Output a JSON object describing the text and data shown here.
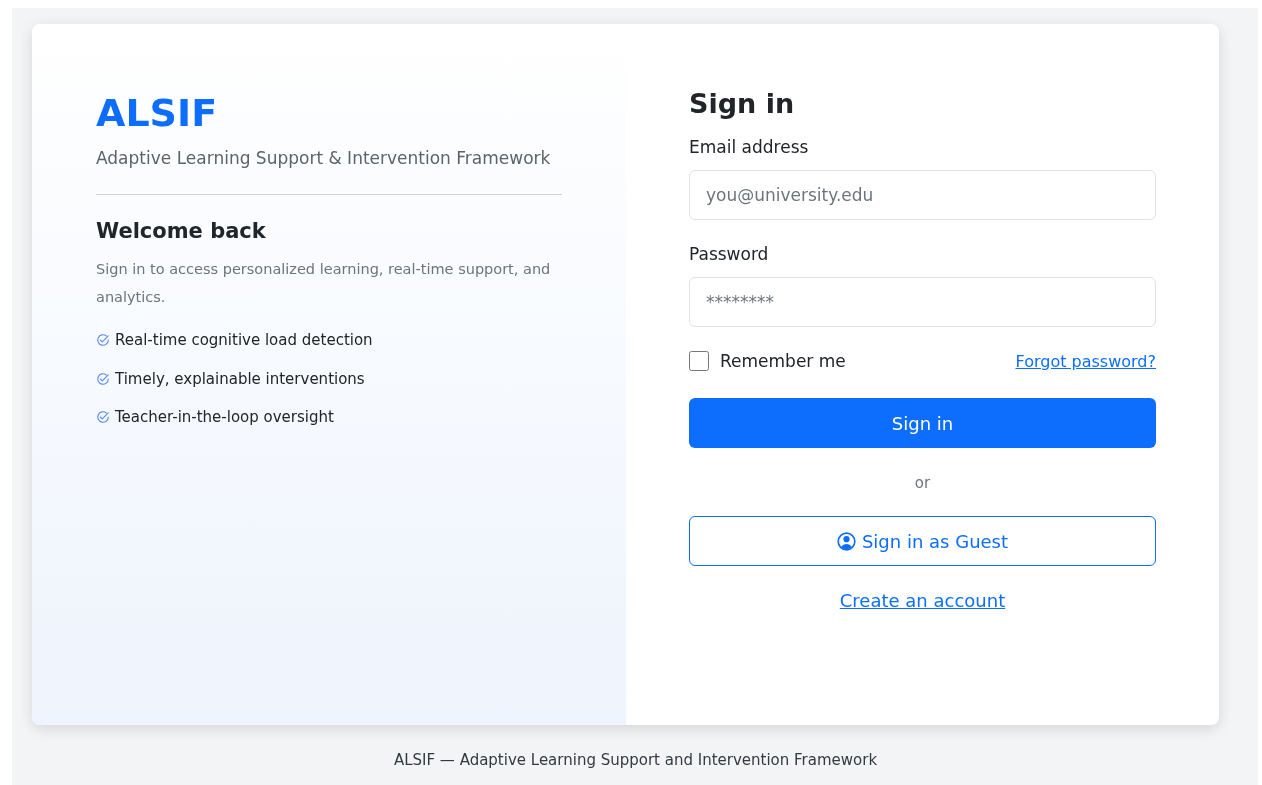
{
  "brand": {
    "logo": "ALSIF",
    "tagline": "Adaptive Learning Support & Intervention Framework"
  },
  "welcome": {
    "title": "Welcome back",
    "text": "Sign in to access personalized learning, real-time support, and analytics.",
    "features": [
      "Real-time cognitive load detection",
      "Timely, explainable interventions",
      "Teacher-in-the-loop oversight"
    ]
  },
  "form": {
    "title": "Sign in",
    "fields": [
      {
        "label": "Email address",
        "placeholder": "you@university.edu"
      },
      {
        "label": "Password",
        "placeholder": "********"
      }
    ],
    "remember": {
      "label": "Remember me",
      "checked": false
    },
    "forgot_link": "Forgot password?",
    "submit": "Sign in",
    "divider": "or",
    "guest_button": "Sign in as Guest",
    "create_link": "Create an account"
  },
  "footer": "ALSIF — Adaptive Learning Support and Intervention Framework"
}
